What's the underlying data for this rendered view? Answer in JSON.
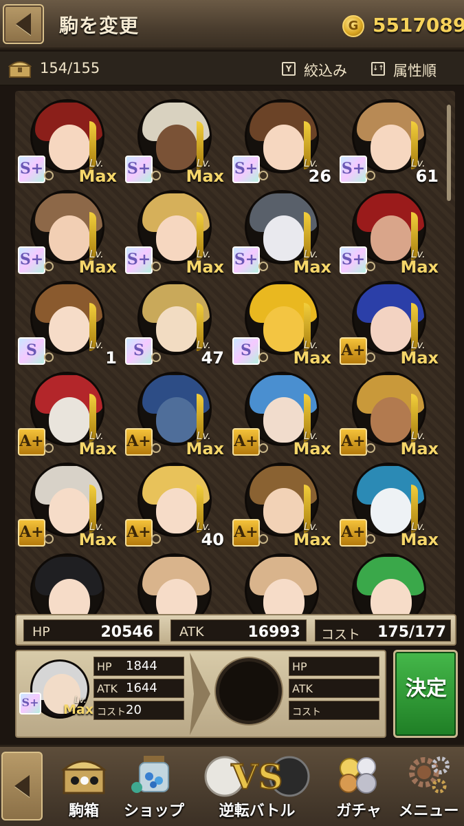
{
  "header": {
    "title": "駒を変更",
    "gold": "5517089",
    "coin_symbol": "G"
  },
  "subbar": {
    "count": "154/155",
    "filter_label": "絞込み",
    "sort_label": "属性順",
    "filter_icon_glyph": "Y",
    "sort_icon_glyph": "↓↑"
  },
  "units": [
    {
      "rank": "S+",
      "lv_label": "Lv.",
      "level": "Max",
      "hair": "#8b1f1a",
      "skin": "#f6d7c0"
    },
    {
      "rank": "S+",
      "lv_label": "Lv.",
      "level": "Max",
      "hair": "#d9d2c0",
      "skin": "#7a5236"
    },
    {
      "rank": "S+",
      "lv_label": "Lv.",
      "level": "26",
      "hair": "#6b4327",
      "skin": "#f6d7c0"
    },
    {
      "rank": "S+",
      "lv_label": "Lv.",
      "level": "61",
      "hair": "#b88a55",
      "skin": "#f6d7c0"
    },
    {
      "rank": "S+",
      "lv_label": "Lv.",
      "level": "Max",
      "hair": "#8d6848",
      "skin": "#f2cfb4"
    },
    {
      "rank": "S+",
      "lv_label": "Lv.",
      "level": "Max",
      "hair": "#d6b05a",
      "skin": "#f6d7c0"
    },
    {
      "rank": "S+",
      "lv_label": "Lv.",
      "level": "Max",
      "hair": "#59606a",
      "skin": "#e9e9ee"
    },
    {
      "rank": "S+",
      "lv_label": "Lv.",
      "level": "Max",
      "hair": "#9a1b1b",
      "skin": "#d9a58a"
    },
    {
      "rank": "S",
      "lv_label": "Lv.",
      "level": "1",
      "hair": "#8a5a2e",
      "skin": "#f6dcc8"
    },
    {
      "rank": "S",
      "lv_label": "Lv.",
      "level": "47",
      "hair": "#c9a95a",
      "skin": "#f2dcc2"
    },
    {
      "rank": "S",
      "lv_label": "Lv.",
      "level": "Max",
      "hair": "#e9b820",
      "skin": "#f3c542"
    },
    {
      "rank": "A+",
      "lv_label": "Lv.",
      "level": "Max",
      "hair": "#2b3fa8",
      "skin": "#f3d3c2"
    },
    {
      "rank": "A+",
      "lv_label": "Lv.",
      "level": "Max",
      "hair": "#b3262a",
      "skin": "#e9e4dc"
    },
    {
      "rank": "A+",
      "lv_label": "Lv.",
      "level": "Max",
      "hair": "#2d4d86",
      "skin": "#4f6e9a"
    },
    {
      "rank": "A+",
      "lv_label": "Lv.",
      "level": "Max",
      "hair": "#4a8fd0",
      "skin": "#f1dccc"
    },
    {
      "rank": "A+",
      "lv_label": "Lv.",
      "level": "Max",
      "hair": "#c9993a",
      "skin": "#b27a4f"
    },
    {
      "rank": "A+",
      "lv_label": "Lv.",
      "level": "Max",
      "hair": "#d8d2c8",
      "skin": "#f6dcc8"
    },
    {
      "rank": "A+",
      "lv_label": "Lv.",
      "level": "40",
      "hair": "#e8c25a",
      "skin": "#f6dcc8"
    },
    {
      "rank": "A+",
      "lv_label": "Lv.",
      "level": "Max",
      "hair": "#8a6232",
      "skin": "#f2d2b6"
    },
    {
      "rank": "A+",
      "lv_label": "Lv.",
      "level": "Max",
      "hair": "#2b8ab5",
      "skin": "#eef2f5"
    },
    {
      "rank": "",
      "lv_label": "",
      "level": "",
      "hair": "#1f1f22",
      "skin": "#f6dcc8"
    },
    {
      "rank": "",
      "lv_label": "",
      "level": "",
      "hair": "#d9b48c",
      "skin": "#f6dcc8"
    },
    {
      "rank": "",
      "lv_label": "",
      "level": "",
      "hair": "#d9b48c",
      "skin": "#f6dcc8"
    },
    {
      "rank": "",
      "lv_label": "",
      "level": "",
      "hair": "#3aa84a",
      "skin": "#f6dcc8"
    }
  ],
  "totals": {
    "hp_label": "HP",
    "hp": "20546",
    "atk_label": "ATK",
    "atk": "16993",
    "cost_label": "コスト",
    "cost": "175/177"
  },
  "selected": {
    "rank": "S+",
    "lv_label": "Lv.",
    "level": "Max",
    "hp_label": "HP",
    "hp": "1844",
    "atk_label": "ATK",
    "atk": "1644",
    "cost_label": "コスト",
    "cost": "20"
  },
  "target": {
    "hp_label": "HP",
    "atk_label": "ATK",
    "cost_label": "コスト"
  },
  "decide_label": "決定",
  "nav": {
    "items": [
      "駒箱",
      "ショップ",
      "逆転バトル",
      "ガチャ",
      "メニュー"
    ],
    "vs_text": "VS"
  }
}
